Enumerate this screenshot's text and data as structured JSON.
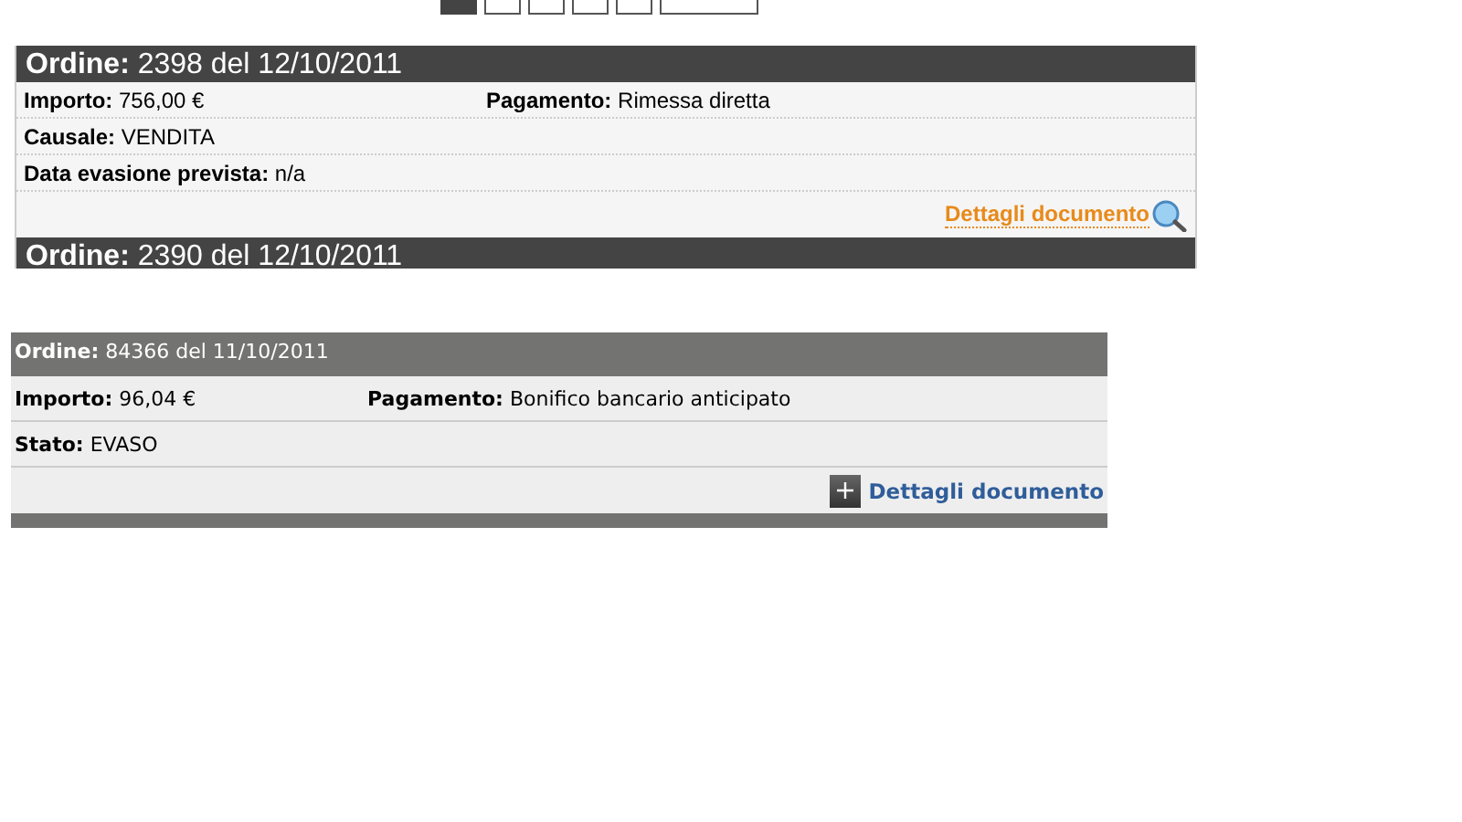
{
  "pagination": [
    {
      "kind": "page",
      "selected": true
    },
    {
      "kind": "page",
      "selected": false
    },
    {
      "kind": "page",
      "selected": false
    },
    {
      "kind": "page",
      "selected": false
    },
    {
      "kind": "page",
      "selected": false
    },
    {
      "kind": "next",
      "selected": false
    }
  ],
  "order_panel": {
    "orders": [
      {
        "title_label": "Ordine:",
        "title_value": "2398 del 12/10/2011",
        "fields": [
          [
            {
              "label": "Importo:",
              "value": "756,00 €"
            },
            {
              "label": "Pagamento:",
              "value": "Rimessa diretta"
            }
          ],
          [
            {
              "label": "Causale:",
              "value": "VENDITA"
            }
          ],
          [
            {
              "label": "Data evasione prevista:",
              "value": "n/a"
            }
          ]
        ],
        "link": "Dettagli documento"
      },
      {
        "title_label": "Ordine:",
        "title_value": "2390 del 12/10/2011"
      }
    ]
  },
  "order_list": {
    "orders": [
      {
        "title_label": "Ordine:",
        "title_value": "84366 del 11/10/2011",
        "fields": [
          [
            {
              "label": "Importo:",
              "value": "96,04 €"
            },
            {
              "label": "Pagamento:",
              "value": "Bonifico bancario anticipato"
            }
          ],
          [
            {
              "label": "Stato:",
              "value": "EVASO"
            }
          ]
        ],
        "link": "Dettagli documento",
        "kind": "full"
      },
      {
        "kind": "bar"
      }
    ]
  }
}
